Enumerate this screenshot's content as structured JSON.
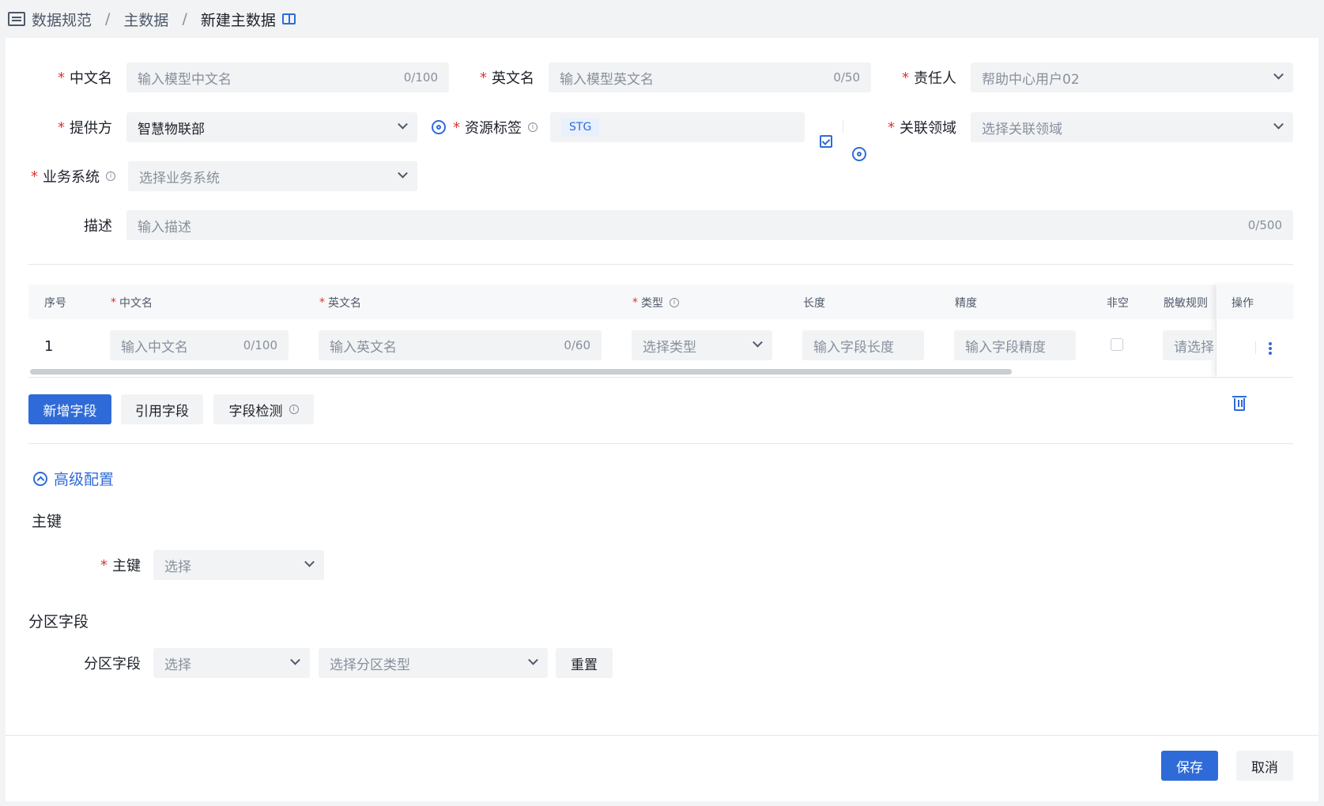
{
  "breadcrumb": {
    "items": [
      "数据规范",
      "主数据",
      "新建主数据"
    ]
  },
  "form": {
    "cn_name": {
      "label": "中文名",
      "placeholder": "输入模型中文名",
      "count": "0/100"
    },
    "en_name": {
      "label": "英文名",
      "placeholder": "输入模型英文名",
      "count": "0/50"
    },
    "owner": {
      "label": "责任人",
      "value": "帮助中心用户02"
    },
    "provider": {
      "label": "提供方",
      "value": "智慧物联部"
    },
    "resource_tag": {
      "label": "资源标签",
      "tag": "STG"
    },
    "domain": {
      "label": "关联领域",
      "placeholder": "选择关联领域"
    },
    "biz_system": {
      "label": "业务系统",
      "placeholder": "选择业务系统"
    },
    "desc": {
      "label": "描述",
      "placeholder": "输入描述",
      "count": "0/500"
    }
  },
  "table": {
    "headers": {
      "index": "序号",
      "cn": "中文名",
      "en": "英文名",
      "type": "类型",
      "length": "长度",
      "precision": "精度",
      "notnull": "非空",
      "mask": "脱敏规则",
      "ops": "操作"
    },
    "row": {
      "index": "1",
      "cn_placeholder": "输入中文名",
      "cn_count": "0/100",
      "en_placeholder": "输入英文名",
      "en_count": "0/60",
      "type_placeholder": "选择类型",
      "length_placeholder": "输入字段长度",
      "precision_placeholder": "输入字段精度",
      "mask_placeholder": "请选择"
    }
  },
  "actions": {
    "add": "新增字段",
    "ref": "引用字段",
    "check": "字段检测"
  },
  "advanced": {
    "toggle": "高级配置"
  },
  "pk": {
    "section": "主键",
    "label": "主键",
    "placeholder": "选择"
  },
  "partition": {
    "section": "分区字段",
    "label": "分区字段",
    "field_placeholder": "选择",
    "type_placeholder": "选择分区类型",
    "reset": "重置"
  },
  "footer": {
    "save": "保存",
    "cancel": "取消"
  },
  "colors": {
    "accent": "#2f6bd8",
    "required": "#e03131"
  }
}
